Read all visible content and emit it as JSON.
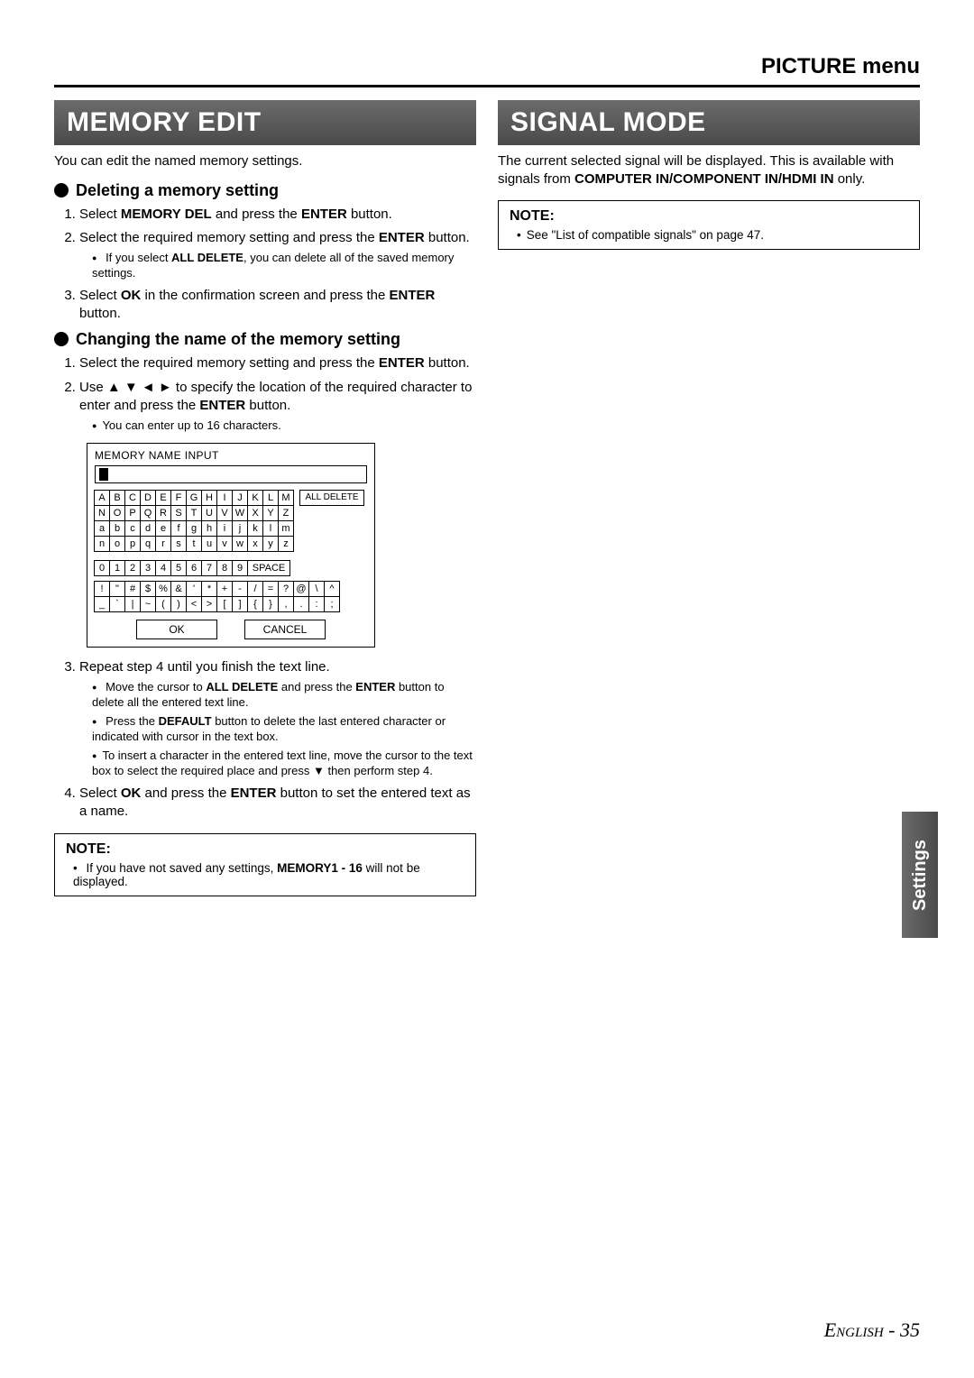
{
  "header": "PICTURE menu",
  "side_tab": "Settings",
  "footer": "English - 35",
  "left": {
    "title": "MEMORY EDIT",
    "intro": "You can edit the named memory settings.",
    "sub1": "Deleting a memory setting",
    "s1_1a": "Select ",
    "s1_1b": "MEMORY DEL",
    "s1_1c": " and press the ",
    "s1_1d": "ENTER",
    "s1_1e": " button.",
    "s1_2a": "Select the required memory setting and press the ",
    "s1_2b": "ENTER",
    "s1_2c": " button.",
    "s1_2_bullet_a": "If you select ",
    "s1_2_bullet_b": "ALL DELETE",
    "s1_2_bullet_c": ", you can delete all of the saved memory settings.",
    "s1_3a": "Select ",
    "s1_3b": "OK",
    "s1_3c": " in the confirmation screen and press the ",
    "s1_3d": "ENTER",
    "s1_3e": " button.",
    "sub2": "Changing the name of the memory setting",
    "s2_1a": "Select the required memory setting and press the ",
    "s2_1b": "ENTER",
    "s2_1c": " button.",
    "s2_2a": "Use ▲ ▼ ◄ ► to specify the location of the required character to enter and press the ",
    "s2_2b": "ENTER",
    "s2_2c": " button.",
    "s2_2_bullet": "You can enter up to 16 characters.",
    "s2_3": "Repeat step 4 until you finish the text line.",
    "s2_3_b1a": "Move the cursor to ",
    "s2_3_b1b": "ALL DELETE",
    "s2_3_b1c": " and press the ",
    "s2_3_b1d": "ENTER",
    "s2_3_b1e": " button to delete all the entered text line.",
    "s2_3_b2a": "Press the ",
    "s2_3_b2b": "DEFAULT",
    "s2_3_b2c": " button to delete the last entered character or indicated with cursor in the text box.",
    "s2_3_b3": "To insert a character in the entered text line, move the cursor to the text box to select the required place and press ▼ then perform step 4.",
    "s2_4a": "Select ",
    "s2_4b": "OK",
    "s2_4c": " and press the ",
    "s2_4d": "ENTER",
    "s2_4e": " button to set the entered text as a name.",
    "note_title": "NOTE:",
    "note_a": "If you have not saved any settings, ",
    "note_b": "MEMORY1 - 16",
    "note_c": " will not be displayed.",
    "kbd": {
      "title": "MEMORY NAME INPUT",
      "row1": [
        "A",
        "B",
        "C",
        "D",
        "E",
        "F",
        "G",
        "H",
        "I",
        "J",
        "K",
        "L",
        "M"
      ],
      "alldelete": "ALL DELETE",
      "row2": [
        "N",
        "O",
        "P",
        "Q",
        "R",
        "S",
        "T",
        "U",
        "V",
        "W",
        "X",
        "Y",
        "Z"
      ],
      "row3": [
        "a",
        "b",
        "c",
        "d",
        "e",
        "f",
        "g",
        "h",
        "i",
        "j",
        "k",
        "l",
        "m"
      ],
      "row4": [
        "n",
        "o",
        "p",
        "q",
        "r",
        "s",
        "t",
        "u",
        "v",
        "w",
        "x",
        "y",
        "z"
      ],
      "row5": [
        "0",
        "1",
        "2",
        "3",
        "4",
        "5",
        "6",
        "7",
        "8",
        "9"
      ],
      "space": "SPACE",
      "row6": [
        "!",
        "\"",
        "#",
        "$",
        "%",
        "&",
        "'",
        "*",
        "+",
        "-",
        "/",
        "=",
        "?",
        "@",
        "\\",
        "^"
      ],
      "row7": [
        "_",
        "`",
        "|",
        "~",
        "(",
        ")",
        "<",
        ">",
        "[",
        "]",
        "{",
        "}",
        ",",
        ".",
        ":",
        ";"
      ],
      "ok": "OK",
      "cancel": "CANCEL"
    }
  },
  "right": {
    "title": "SIGNAL MODE",
    "intro_a": "The current selected signal will be displayed. This is available with signals from ",
    "intro_b": "COMPUTER IN/COMPONENT IN/HDMI IN",
    "intro_c": " only.",
    "note_title": "NOTE:",
    "note_item": "See \"List of compatible signals\" on page 47."
  }
}
